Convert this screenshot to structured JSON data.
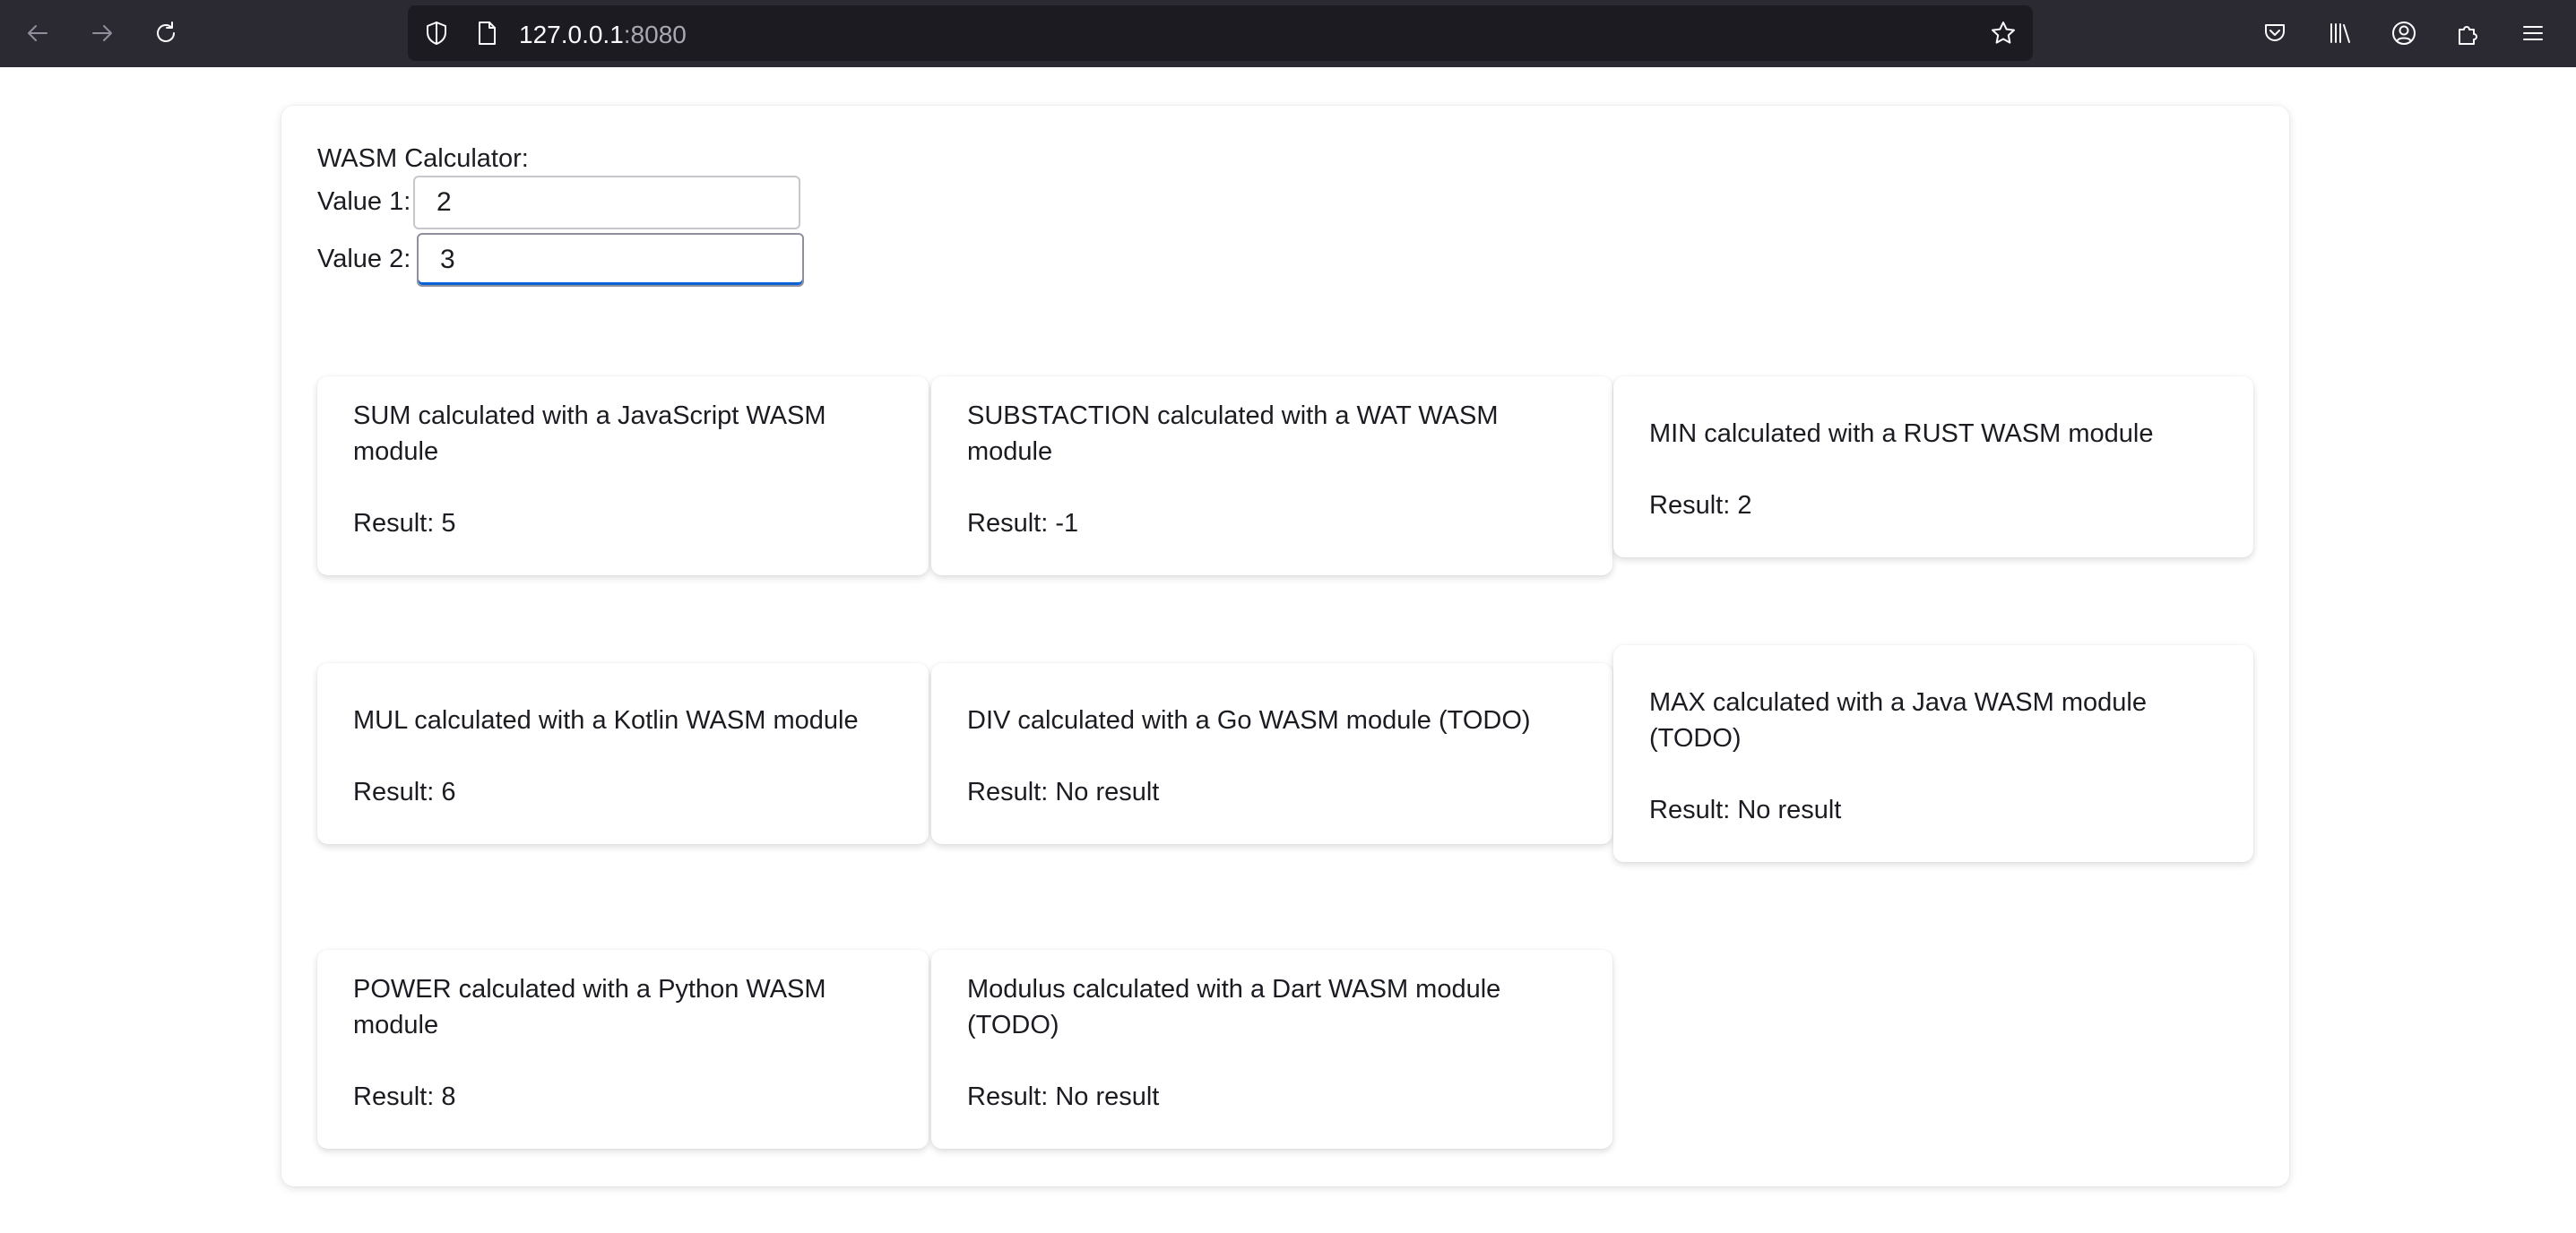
{
  "browser": {
    "url_host": "127.0.0.1",
    "url_port": ":8080"
  },
  "calculator": {
    "title": "WASM Calculator:",
    "value1_label": "Value 1:",
    "value1": "2",
    "value2_label": "Value 2:",
    "value2": "3"
  },
  "results": [
    {
      "desc": "SUM calculated with a JavaScript WASM module",
      "result": "Result: 5"
    },
    {
      "desc": "SUBSTACTION calculated with a WAT WASM module",
      "result": "Result: -1"
    },
    {
      "desc": "MIN calculated with a RUST WASM module",
      "result": "Result: 2"
    },
    {
      "desc": "MUL calculated with a Kotlin WASM module",
      "result": "Result: 6"
    },
    {
      "desc": "DIV calculated with a Go WASM module (TODO)",
      "result": "Result: No result"
    },
    {
      "desc": "MAX calculated with a Java WASM module (TODO)",
      "result": "Result: No result"
    },
    {
      "desc": "POWER calculated with a Python WASM module",
      "result": "Result: 8"
    },
    {
      "desc": "Modulus calculated with a Dart WASM module (TODO)",
      "result": "Result: No result"
    }
  ]
}
